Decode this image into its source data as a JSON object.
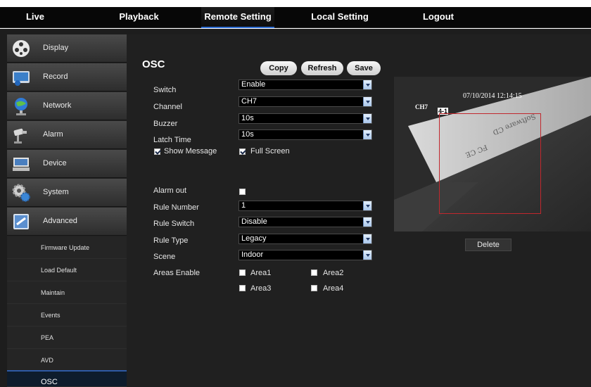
{
  "nav": {
    "live": "Live",
    "playback": "Playback",
    "remote_setting": "Remote Setting",
    "local_setting": "Local Setting",
    "logout": "Logout"
  },
  "sidebar": {
    "main": [
      {
        "label": "Display",
        "icon": "display-icon"
      },
      {
        "label": "Record",
        "icon": "record-icon"
      },
      {
        "label": "Network",
        "icon": "network-icon"
      },
      {
        "label": "Alarm",
        "icon": "alarm-icon"
      },
      {
        "label": "Device",
        "icon": "device-icon"
      },
      {
        "label": "System",
        "icon": "system-icon"
      },
      {
        "label": "Advanced",
        "icon": "advanced-icon"
      }
    ],
    "sub": [
      "Firmware Update",
      "Load Default",
      "Maintain",
      "Events",
      "PEA",
      "AVD",
      "OSC"
    ],
    "active_sub": "OSC"
  },
  "page": {
    "title": "OSC",
    "buttons": {
      "copy": "Copy",
      "refresh": "Refresh",
      "save": "Save"
    }
  },
  "form": {
    "switch": {
      "label": "Switch",
      "value": "Enable"
    },
    "channel": {
      "label": "Channel",
      "value": "CH7"
    },
    "buzzer": {
      "label": "Buzzer",
      "value": "10s"
    },
    "latch_time": {
      "label": "Latch Time",
      "value": "10s"
    },
    "show_message": {
      "label": "Show Message",
      "checked": true
    },
    "full_screen": {
      "label": "Full Screen",
      "checked": true
    },
    "alarm_out": {
      "label": "Alarm out",
      "checked": false
    },
    "rule_number": {
      "label": "Rule Number",
      "value": "1"
    },
    "rule_switch": {
      "label": "Rule Switch",
      "value": "Disable"
    },
    "rule_type": {
      "label": "Rule Type",
      "value": "Legacy"
    },
    "scene": {
      "label": "Scene",
      "value": "Indoor"
    },
    "areas_enable": {
      "label": "Areas Enable",
      "areas": [
        {
          "label": "Area1",
          "checked": false
        },
        {
          "label": "Area2",
          "checked": false
        },
        {
          "label": "Area3",
          "checked": false
        },
        {
          "label": "Area4",
          "checked": false
        }
      ]
    }
  },
  "preview": {
    "timestamp": "07/10/2014 12:14:15",
    "channel": "CH7",
    "rule_tag": "4-1",
    "delete_label": "Delete"
  },
  "colors": {
    "accent": "#2f6fd6",
    "rule_box": "#c1272d"
  }
}
